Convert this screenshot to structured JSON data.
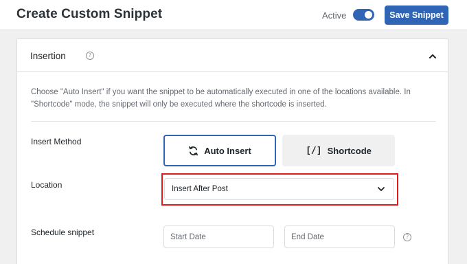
{
  "header": {
    "title": "Create Custom Snippet",
    "active_label": "Active",
    "active_state": "on",
    "save_label": "Save Snippet",
    "accent_color": "#3065b5"
  },
  "insertion": {
    "title": "Insertion",
    "description": "Choose \"Auto Insert\" if you want the snippet to be automatically executed in one of the locations available. In \"Shortcode\" mode, the snippet will only be executed where the shortcode is inserted.",
    "insert_method": {
      "label": "Insert Method",
      "options": [
        {
          "label": "Auto Insert",
          "icon": "refresh-icon",
          "selected": true
        },
        {
          "label": "Shortcode",
          "icon": "shortcode-icon",
          "glyph": "[/]",
          "selected": false
        }
      ]
    },
    "location": {
      "label": "Location",
      "selected": "Insert After Post",
      "highlight_color": "#e01b1b"
    },
    "schedule": {
      "label": "Schedule snippet",
      "start_placeholder": "Start Date",
      "end_placeholder": "End Date"
    }
  }
}
